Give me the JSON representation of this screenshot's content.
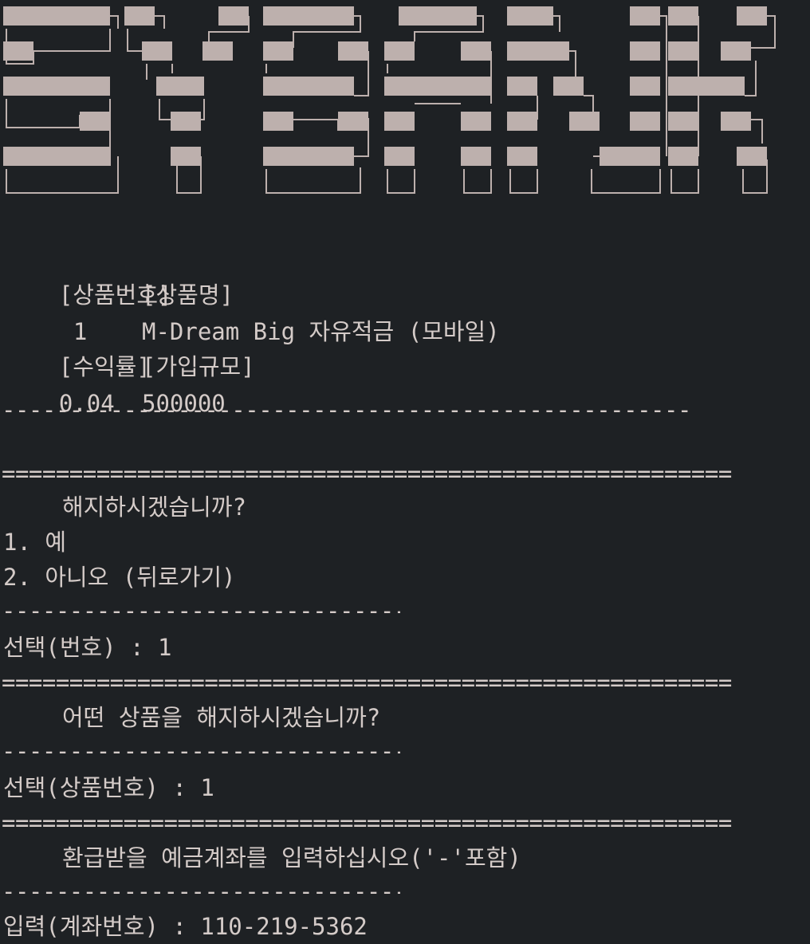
{
  "terminal": {
    "banner_text": "SYBANK",
    "product": {
      "header_no": "[상품번호]",
      "header_name": "[상품명]",
      "no": "1",
      "name": "M-Dream Big 자유적금 (모바일)",
      "header_rate": "[수익률]",
      "header_scale": "[가입규모]",
      "rate": "0.04",
      "scale": "500000"
    },
    "divider_dash_long": "---------------------------------------------------------",
    "divider_eq": "======================================================",
    "divider_dash_short": "---------------------------------",
    "prompt1": {
      "question": "해지하시겠습니까?",
      "option1": "1. 예",
      "option2": "2. 아니오 (뒤로가기)",
      "input_line": "선택(번호) : 1"
    },
    "prompt2": {
      "question": "어떤 상품을 해지하시겠습니까?",
      "input_line": "선택(상품번호) : 1"
    },
    "prompt3": {
      "question": "환급받을 예금계좌를 입력하십시오('-'포함)",
      "input_line": "입력(계좌번호) : 110-219-5362"
    },
    "colors": {
      "background": "#1e2124",
      "text": "#d4cbc8",
      "block_fill": "#bdb0ad"
    }
  }
}
